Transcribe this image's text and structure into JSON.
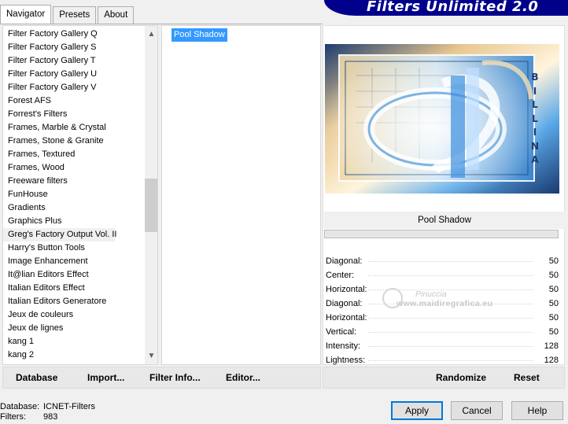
{
  "tabs": [
    {
      "label": "Navigator",
      "active": true
    },
    {
      "label": "Presets",
      "active": false
    },
    {
      "label": "About",
      "active": false
    }
  ],
  "banner": {
    "title": "Filters Unlimited 2.0"
  },
  "categories": {
    "items": [
      "Filter Factory Gallery Q",
      "Filter Factory Gallery S",
      "Filter Factory Gallery T",
      "Filter Factory Gallery U",
      "Filter Factory Gallery V",
      "Forest AFS",
      "Forrest's Filters",
      "Frames, Marble & Crystal",
      "Frames, Stone & Granite",
      "Frames, Textured",
      "Frames, Wood",
      "Freeware filters",
      "FunHouse",
      "Gradients",
      "Graphics Plus",
      "Greg's Factory Output Vol. II",
      "Harry's Button Tools",
      "Image Enhancement",
      "It@lian Editors Effect",
      "Italian Editors Effect",
      "Italian Editors Generatore",
      "Jeux de couleurs",
      "Jeux de lignes",
      "kang 1",
      "kang 2"
    ],
    "selected_index": 15
  },
  "filters": {
    "items": [
      "Pool Shadow"
    ],
    "selected": "Pool Shadow"
  },
  "preview": {
    "filter_title": "Pool Shadow",
    "side_text": "BILLINA",
    "params": [
      {
        "label": "Diagonal:",
        "value": "50"
      },
      {
        "label": "Center:",
        "value": "50"
      },
      {
        "label": "Horizontal:",
        "value": "50"
      },
      {
        "label": "Diagonal:",
        "value": "50"
      },
      {
        "label": "Horizontal:",
        "value": "50"
      },
      {
        "label": "Vertical:",
        "value": "50"
      },
      {
        "label": "Intensity:",
        "value": "128"
      },
      {
        "label": "Lightness:",
        "value": "128"
      }
    ]
  },
  "watermark": {
    "name": "Pinuccia",
    "site": "www.maidiregrafica.eu"
  },
  "bottom_left_buttons": [
    "Database",
    "Import...",
    "Filter Info...",
    "Editor..."
  ],
  "bottom_right_buttons": [
    "Randomize",
    "Reset"
  ],
  "status": {
    "database_label": "Database:",
    "database_value": "ICNET-Filters",
    "filters_label": "Filters:",
    "filters_value": "983"
  },
  "dialog_buttons": {
    "apply": "Apply",
    "cancel": "Cancel",
    "help": "Help"
  },
  "colors": {
    "banner": "#00008b",
    "selection": "#3399ff",
    "default_button_border": "#0078d7"
  }
}
